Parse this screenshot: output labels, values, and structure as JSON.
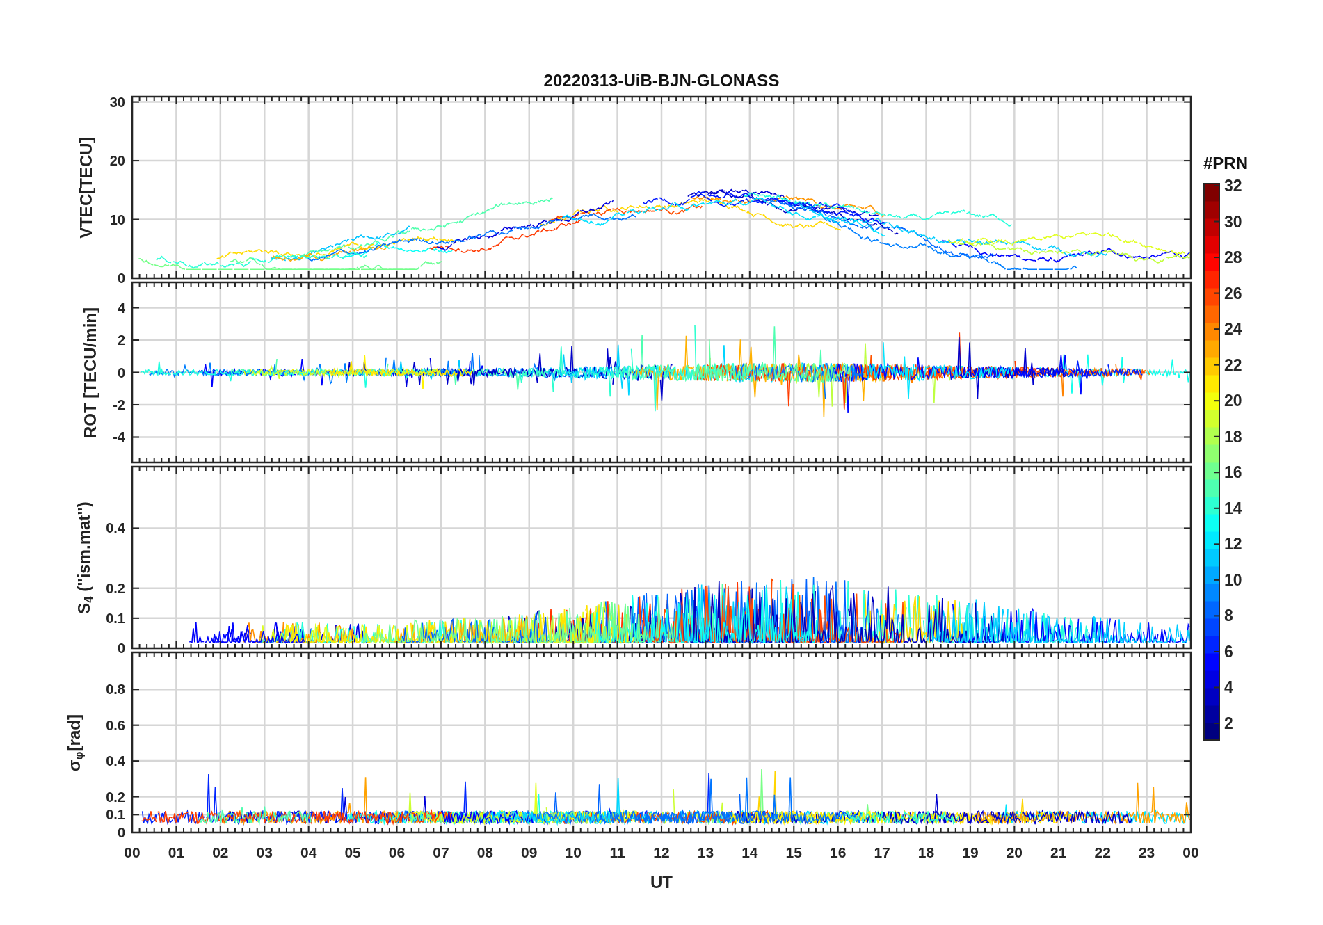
{
  "figure": {
    "title": "20220313-UiB-BJN-GLONASS",
    "xlabel": "UT",
    "xticks": [
      "00",
      "01",
      "02",
      "03",
      "04",
      "05",
      "06",
      "07",
      "08",
      "09",
      "10",
      "11",
      "12",
      "13",
      "14",
      "15",
      "16",
      "17",
      "18",
      "19",
      "20",
      "21",
      "22",
      "23",
      "00"
    ],
    "panels": [
      {
        "ylabel": "VTEC[TECU]",
        "yticks": [
          "30",
          "20",
          "10",
          "0"
        ]
      },
      {
        "ylabel": "ROT [TECU/min]",
        "yticks": [
          "4",
          "2",
          "0",
          "-2",
          "-4"
        ]
      },
      {
        "ylabel": "S$_{4}$ (\"ism.mat\")",
        "yticks": [
          "0.4",
          "0.2",
          "0.1",
          "0"
        ]
      },
      {
        "ylabel": "σ$_{φ}$[rad]",
        "yticks": [
          "0.8",
          "0.6",
          "0.4",
          "0.2",
          "0.1",
          "0"
        ]
      }
    ],
    "colorbar": {
      "title": "#PRN",
      "ticks": [
        "32",
        "30",
        "28",
        "26",
        "24",
        "22",
        "20",
        "18",
        "16",
        "14",
        "12",
        "10",
        "8",
        "6",
        "4",
        "2"
      ]
    }
  }
}
